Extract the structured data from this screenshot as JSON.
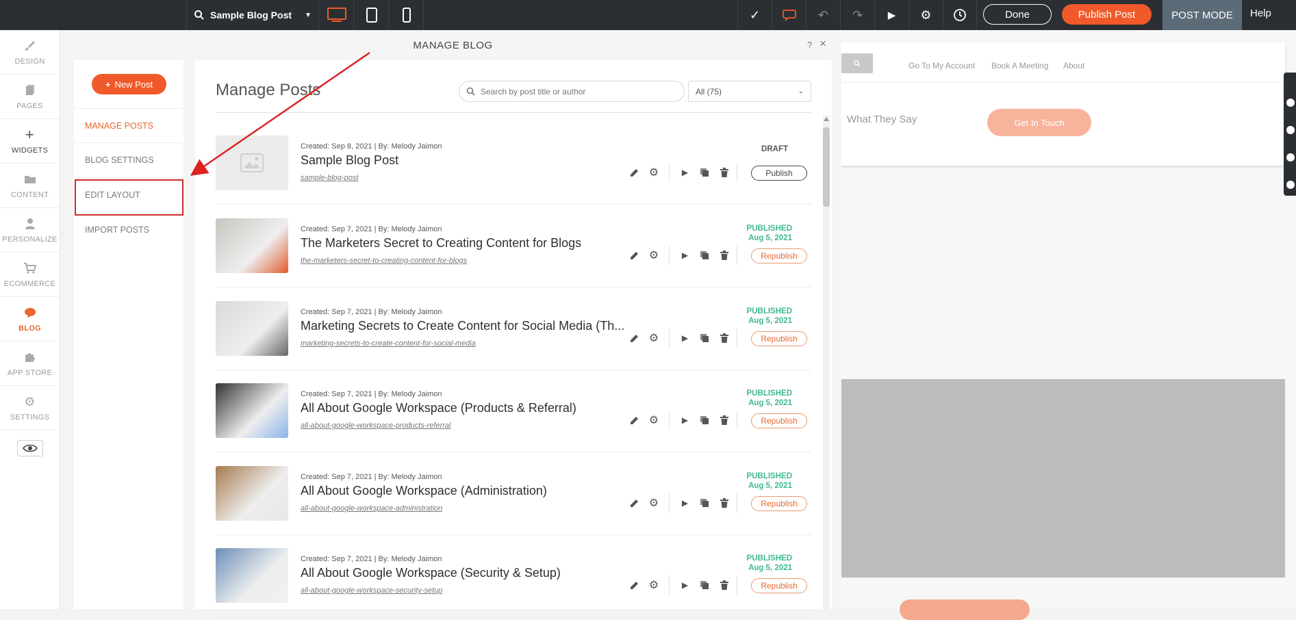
{
  "topbar": {
    "page_select": "Sample Blog Post",
    "done_label": "Done",
    "publish_label": "Publish Post",
    "mode_label": "POST MODE",
    "help_label": "Help",
    "accent": "#f05a2a"
  },
  "leftnav": {
    "items": [
      {
        "label": "DESIGN",
        "icon": "brush-icon"
      },
      {
        "label": "PAGES",
        "icon": "pages-icon"
      },
      {
        "label": "WIDGETS",
        "icon": "plus-icon"
      },
      {
        "label": "CONTENT",
        "icon": "folder-icon"
      },
      {
        "label": "PERSONALIZE",
        "icon": "person-icon"
      },
      {
        "label": "ECOMMERCE",
        "icon": "cart-icon"
      },
      {
        "label": "BLOG",
        "icon": "chat-bubble-icon"
      },
      {
        "label": "APP STORE",
        "icon": "puzzle-icon"
      },
      {
        "label": "SETTINGS",
        "icon": "gear-icon"
      }
    ]
  },
  "modal": {
    "title": "MANAGE BLOG",
    "help": "?",
    "close": "×"
  },
  "subnav": {
    "new_post": "New Post",
    "items": [
      {
        "label": "MANAGE POSTS"
      },
      {
        "label": "BLOG SETTINGS"
      },
      {
        "label": "EDIT LAYOUT"
      },
      {
        "label": "IMPORT POSTS"
      }
    ]
  },
  "main": {
    "title": "Manage Posts",
    "search_placeholder": "Search by post title or author",
    "filter": "All (75)"
  },
  "posts": [
    {
      "meta": "Created: Sep 8, 2021 | By: Melody Jaimon",
      "title": "Sample Blog Post",
      "slug": "sample-blog-post",
      "status": "DRAFT",
      "date": "",
      "action": "Publish"
    },
    {
      "meta": "Created: Sep 7, 2021 | By: Melody Jaimon",
      "title": "The Marketers Secret to Creating Content for Blogs",
      "slug": "the-marketers-secret-to-creating-content-for-blogs",
      "status": "PUBLISHED",
      "date": "Aug 5, 2021",
      "action": "Republish"
    },
    {
      "meta": "Created: Sep 7, 2021 | By: Melody Jaimon",
      "title": "Marketing Secrets to Create Content for Social Media (Th...",
      "slug": "marketing-secrets-to-create-content-for-social-media",
      "status": "PUBLISHED",
      "date": "Aug 5, 2021",
      "action": "Republish"
    },
    {
      "meta": "Created: Sep 7, 2021 | By: Melody Jaimon",
      "title": "All About Google Workspace (Products & Referral)",
      "slug": "all-about-google-workspace-products-referral",
      "status": "PUBLISHED",
      "date": "Aug 5, 2021",
      "action": "Republish"
    },
    {
      "meta": "Created: Sep 7, 2021 | By: Melody Jaimon",
      "title": "All About Google Workspace (Administration)",
      "slug": "all-about-google-workspace-administration",
      "status": "PUBLISHED",
      "date": "Aug 5, 2021",
      "action": "Republish"
    },
    {
      "meta": "Created: Sep 7, 2021 | By: Melody Jaimon",
      "title": "All About Google Workspace (Security & Setup)",
      "slug": "all-about-google-workspace-security-setup",
      "status": "PUBLISHED",
      "date": "Aug 5, 2021",
      "action": "Republish"
    }
  ],
  "preview": {
    "links": [
      "Go To My Account",
      "Book A Meeting",
      "About"
    ],
    "section_text": "What They Say",
    "cta": "Get In Touch"
  }
}
